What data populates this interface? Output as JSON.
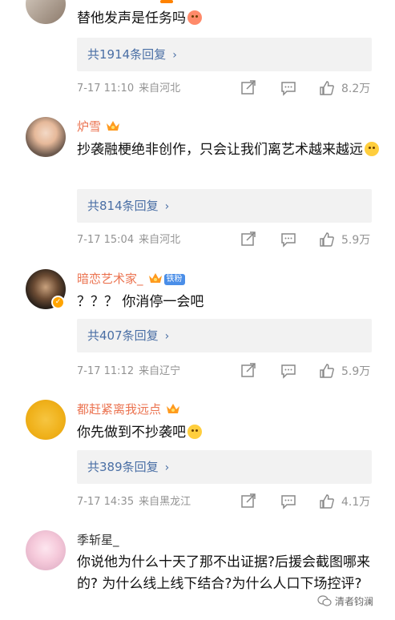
{
  "comments": [
    {
      "username": "",
      "text": "替他发声是任务吗",
      "replies": "共1914条回复",
      "time": "7-17 11:10",
      "source": "来自河北",
      "likes": "8.2万"
    },
    {
      "username": "炉雪",
      "text": "抄袭融梗绝非创作，只会让我们离艺术越来越远",
      "replies": "共814条回复",
      "time": "7-17 15:04",
      "source": "来自河北",
      "likes": "5.9万"
    },
    {
      "username": "暗恋艺术家_",
      "badge": "铁粉",
      "text": "？？？ 你消停一会吧",
      "replies": "共407条回复",
      "time": "7-17 11:12",
      "source": "来自辽宁",
      "likes": "5.9万"
    },
    {
      "username": "都赶紧离我远点",
      "text": "你先做到不抄袭吧",
      "replies": "共389条回复",
      "time": "7-17 14:35",
      "source": "来自黑龙江",
      "likes": "4.1万"
    },
    {
      "username": "季斩星_",
      "text": "你说他为什么十天了那不出证据?后援会截图哪来的? 为什么线上线下结合?为什么人口下场控评?"
    }
  ],
  "watermark": "清者钧澜",
  "colors": {
    "username": "#eb7350",
    "reply_link": "#4a6fa5",
    "meta": "#939393",
    "accent": "#ff8200"
  },
  "icons": [
    "share-icon",
    "comment-icon",
    "like-icon",
    "vip-crown-icon",
    "smile-emoji-icon",
    "wechat-icon"
  ]
}
